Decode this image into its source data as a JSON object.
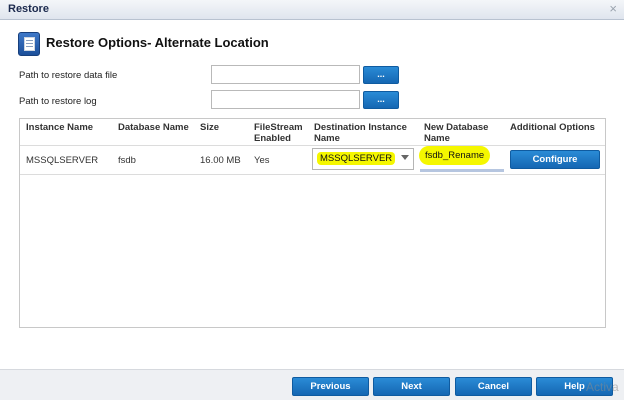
{
  "window": {
    "title": "Restore",
    "close_glyph": "×"
  },
  "header": {
    "icon": "document-list-icon",
    "title": "Restore Options- Alternate Location"
  },
  "form": {
    "data_file_label": "Path to restore data file",
    "data_file_value": "",
    "log_label": "Path to restore log",
    "log_value": "",
    "browse_label": "..."
  },
  "grid": {
    "columns": [
      "Instance Name",
      "Database Name",
      "Size",
      "FileStream\nEnabled",
      "Destination Instance\nName",
      "New Database\nName",
      "Additional Options"
    ],
    "rows": [
      {
        "instance": "MSSQLSERVER",
        "database": "fsdb",
        "size": "16.00 MB",
        "filestream": "Yes",
        "destination": "MSSQLSERVER",
        "new_name": "fsdb_Rename",
        "action": "Configure"
      }
    ]
  },
  "footer": {
    "previous": "Previous",
    "next": "Next",
    "cancel": "Cancel",
    "help": "Help",
    "watermark": "Activa"
  },
  "colors": {
    "button_blue": "#1a73c2",
    "highlight": "#f5f700",
    "title_text": "#1c2a4e"
  }
}
